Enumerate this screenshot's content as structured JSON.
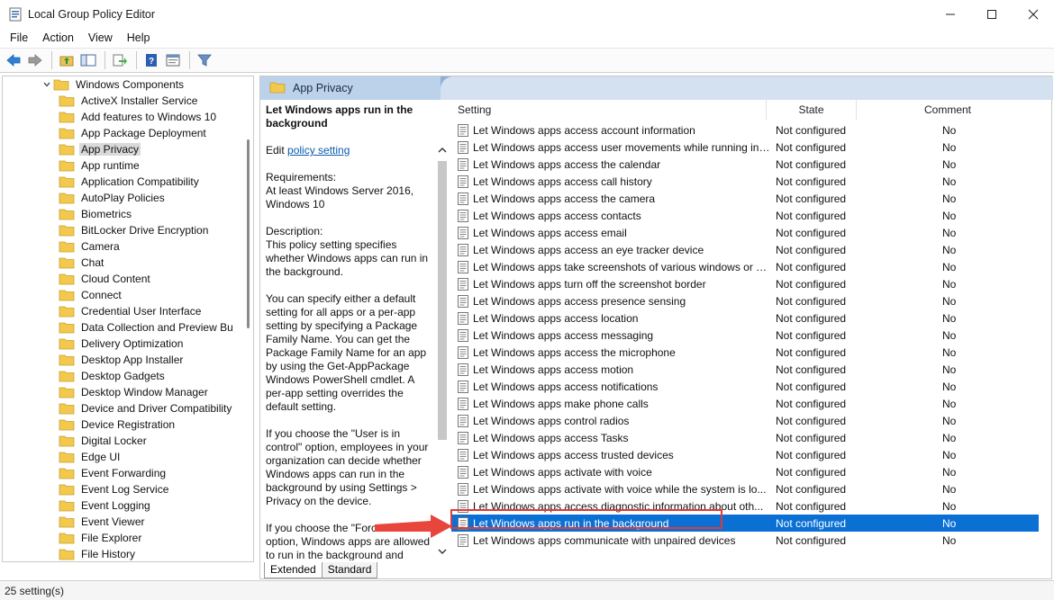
{
  "window": {
    "title": "Local Group Policy Editor",
    "icon": "policy-editor-icon"
  },
  "menu": [
    "File",
    "Action",
    "View",
    "Help"
  ],
  "tree": {
    "root": "Windows Components",
    "items": [
      {
        "label": "ActiveX Installer Service",
        "expandable": false
      },
      {
        "label": "Add features to Windows 10",
        "expandable": false
      },
      {
        "label": "App Package Deployment",
        "expandable": false
      },
      {
        "label": "App Privacy",
        "expandable": false,
        "selected": true
      },
      {
        "label": "App runtime",
        "expandable": false
      },
      {
        "label": "Application Compatibility",
        "expandable": false
      },
      {
        "label": "AutoPlay Policies",
        "expandable": false
      },
      {
        "label": "Biometrics",
        "expandable": true
      },
      {
        "label": "BitLocker Drive Encryption",
        "expandable": true
      },
      {
        "label": "Camera",
        "expandable": false
      },
      {
        "label": "Chat",
        "expandable": false
      },
      {
        "label": "Cloud Content",
        "expandable": false
      },
      {
        "label": "Connect",
        "expandable": false
      },
      {
        "label": "Credential User Interface",
        "expandable": false
      },
      {
        "label": "Data Collection and Preview Bu",
        "expandable": false
      },
      {
        "label": "Delivery Optimization",
        "expandable": false
      },
      {
        "label": "Desktop App Installer",
        "expandable": false
      },
      {
        "label": "Desktop Gadgets",
        "expandable": false
      },
      {
        "label": "Desktop Window Manager",
        "expandable": true
      },
      {
        "label": "Device and Driver Compatibility",
        "expandable": false
      },
      {
        "label": "Device Registration",
        "expandable": false
      },
      {
        "label": "Digital Locker",
        "expandable": false
      },
      {
        "label": "Edge UI",
        "expandable": false
      },
      {
        "label": "Event Forwarding",
        "expandable": false
      },
      {
        "label": "Event Log Service",
        "expandable": true
      },
      {
        "label": "Event Logging",
        "expandable": false
      },
      {
        "label": "Event Viewer",
        "expandable": false
      },
      {
        "label": "File Explorer",
        "expandable": true
      },
      {
        "label": "File History",
        "expandable": false
      }
    ]
  },
  "header": {
    "title": "App Privacy"
  },
  "description": {
    "title": "Let Windows apps run in the background",
    "edit_prefix": "Edit ",
    "edit_link": "policy setting",
    "requirements_label": "Requirements:",
    "requirements": "At least Windows Server 2016, Windows 10",
    "description_label": "Description:",
    "p1": "This policy setting specifies whether Windows apps can run in the background.",
    "p2": "You can specify either a default setting for all apps or a per-app setting by specifying a Package Family Name. You can get the Package Family Name for an app by using the Get-AppPackage Windows PowerShell cmdlet. A per-app setting overrides the default setting.",
    "p3": "If you choose the \"User is in control\" option, employees in your organization can decide whether Windows apps can run in the background by using Settings > Privacy on the device.",
    "p4": "If you choose the \"Force Allow\" option, Windows apps are allowed to run in the background and"
  },
  "tabs": [
    "Extended",
    "Standard"
  ],
  "table": {
    "columns": [
      "Setting",
      "State",
      "Comment"
    ],
    "rows": [
      {
        "setting": "Let Windows apps access account information",
        "state": "Not configured",
        "comment": "No"
      },
      {
        "setting": "Let Windows apps access user movements while running in ...",
        "state": "Not configured",
        "comment": "No"
      },
      {
        "setting": "Let Windows apps access the calendar",
        "state": "Not configured",
        "comment": "No"
      },
      {
        "setting": "Let Windows apps access call history",
        "state": "Not configured",
        "comment": "No"
      },
      {
        "setting": "Let Windows apps access the camera",
        "state": "Not configured",
        "comment": "No"
      },
      {
        "setting": "Let Windows apps access contacts",
        "state": "Not configured",
        "comment": "No"
      },
      {
        "setting": "Let Windows apps access email",
        "state": "Not configured",
        "comment": "No"
      },
      {
        "setting": "Let Windows apps access an eye tracker device",
        "state": "Not configured",
        "comment": "No"
      },
      {
        "setting": "Let Windows apps take screenshots of various windows or d...",
        "state": "Not configured",
        "comment": "No"
      },
      {
        "setting": "Let Windows apps turn off the screenshot border",
        "state": "Not configured",
        "comment": "No"
      },
      {
        "setting": "Let Windows apps access presence sensing",
        "state": "Not configured",
        "comment": "No"
      },
      {
        "setting": "Let Windows apps access location",
        "state": "Not configured",
        "comment": "No"
      },
      {
        "setting": "Let Windows apps access messaging",
        "state": "Not configured",
        "comment": "No"
      },
      {
        "setting": "Let Windows apps access the microphone",
        "state": "Not configured",
        "comment": "No"
      },
      {
        "setting": "Let Windows apps access motion",
        "state": "Not configured",
        "comment": "No"
      },
      {
        "setting": "Let Windows apps access notifications",
        "state": "Not configured",
        "comment": "No"
      },
      {
        "setting": "Let Windows apps make phone calls",
        "state": "Not configured",
        "comment": "No"
      },
      {
        "setting": "Let Windows apps control radios",
        "state": "Not configured",
        "comment": "No"
      },
      {
        "setting": "Let Windows apps access Tasks",
        "state": "Not configured",
        "comment": "No"
      },
      {
        "setting": "Let Windows apps access trusted devices",
        "state": "Not configured",
        "comment": "No"
      },
      {
        "setting": "Let Windows apps activate with voice",
        "state": "Not configured",
        "comment": "No"
      },
      {
        "setting": "Let Windows apps activate with voice while the system is lo...",
        "state": "Not configured",
        "comment": "No"
      },
      {
        "setting": "Let Windows apps access diagnostic information about oth...",
        "state": "Not configured",
        "comment": "No"
      },
      {
        "setting": "Let Windows apps run in the background",
        "state": "Not configured",
        "comment": "No",
        "selected": true
      },
      {
        "setting": "Let Windows apps communicate with unpaired devices",
        "state": "Not configured",
        "comment": "No"
      }
    ]
  },
  "status": "25 setting(s)",
  "colors": {
    "selection": "#0a70d4",
    "highlight": "#e03a3a",
    "header_band": "#bcd1ea"
  }
}
